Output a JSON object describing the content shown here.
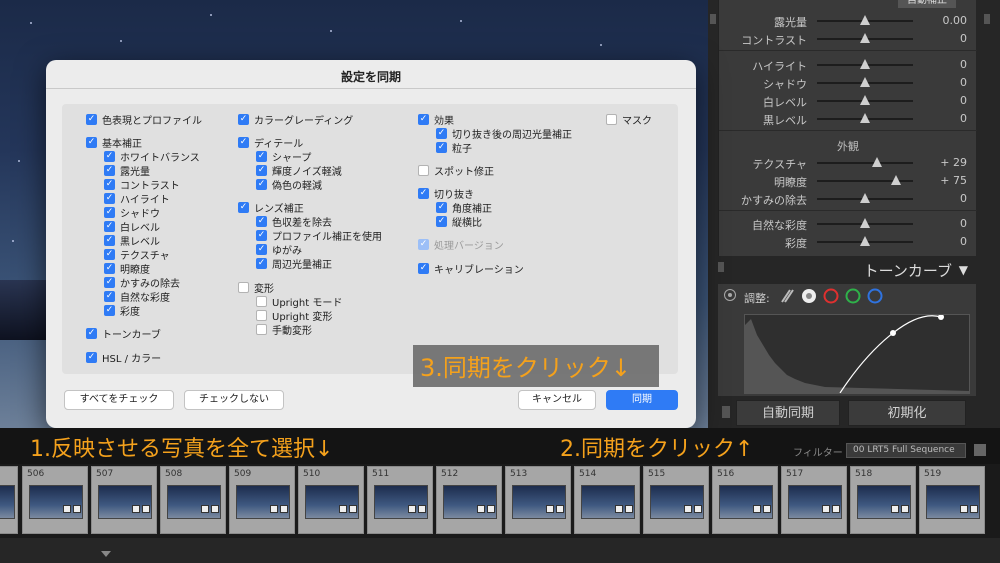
{
  "right_panel": {
    "auto_tab": "自動補正",
    "rows_top": [
      {
        "label": "露光量",
        "value": "0.00",
        "pos": 0.5
      },
      {
        "label": "コントラスト",
        "value": "0",
        "pos": 0.5
      }
    ],
    "rows_tone": [
      {
        "label": "ハイライト",
        "value": "0",
        "pos": 0.5
      },
      {
        "label": "シャドウ",
        "value": "0",
        "pos": 0.5
      },
      {
        "label": "白レベル",
        "value": "0",
        "pos": 0.5
      },
      {
        "label": "黒レベル",
        "value": "0",
        "pos": 0.5
      }
    ],
    "presence_header": "外観",
    "rows_presence": [
      {
        "label": "テクスチャ",
        "value": "+ 29",
        "pos": 0.62
      },
      {
        "label": "明瞭度",
        "value": "+ 75",
        "pos": 0.82
      },
      {
        "label": "かすみの除去",
        "value": "0",
        "pos": 0.5
      }
    ],
    "rows_color": [
      {
        "label": "自然な彩度",
        "value": "0",
        "pos": 0.5
      },
      {
        "label": "彩度",
        "value": "0",
        "pos": 0.5
      }
    ],
    "tone_curve_title": "トーンカーブ",
    "tone_curve_toggle": "▼",
    "curve_adjust_label": "調整:",
    "btn_auto_sync": "自動同期",
    "btn_reset": "初期化"
  },
  "dialog": {
    "title": "設定を同期",
    "col1": [
      {
        "label": "色表現とプロファイル",
        "checked": true,
        "indent": false
      },
      {
        "label": "基本補正",
        "checked": true,
        "indent": false
      },
      {
        "label": "ホワイトバランス",
        "checked": true,
        "indent": true
      },
      {
        "label": "露光量",
        "checked": true,
        "indent": true
      },
      {
        "label": "コントラスト",
        "checked": true,
        "indent": true
      },
      {
        "label": "ハイライト",
        "checked": true,
        "indent": true
      },
      {
        "label": "シャドウ",
        "checked": true,
        "indent": true
      },
      {
        "label": "白レベル",
        "checked": true,
        "indent": true
      },
      {
        "label": "黒レベル",
        "checked": true,
        "indent": true
      },
      {
        "label": "テクスチャ",
        "checked": true,
        "indent": true
      },
      {
        "label": "明瞭度",
        "checked": true,
        "indent": true
      },
      {
        "label": "かすみの除去",
        "checked": true,
        "indent": true
      },
      {
        "label": "自然な彩度",
        "checked": true,
        "indent": true
      },
      {
        "label": "彩度",
        "checked": true,
        "indent": true
      },
      {
        "label": "トーンカーブ",
        "checked": true,
        "indent": false
      },
      {
        "label": "HSL / カラー",
        "checked": true,
        "indent": false
      }
    ],
    "col2": [
      {
        "label": "カラーグレーディング",
        "checked": true,
        "indent": false
      },
      {
        "label": "ディテール",
        "checked": true,
        "indent": false
      },
      {
        "label": "シャープ",
        "checked": true,
        "indent": true
      },
      {
        "label": "輝度ノイズ軽減",
        "checked": true,
        "indent": true
      },
      {
        "label": "偽色の軽減",
        "checked": true,
        "indent": true
      },
      {
        "label": "レンズ補正",
        "checked": true,
        "indent": false
      },
      {
        "label": "色収差を除去",
        "checked": true,
        "indent": true
      },
      {
        "label": "プロファイル補正を使用",
        "checked": true,
        "indent": true
      },
      {
        "label": "ゆがみ",
        "checked": true,
        "indent": true
      },
      {
        "label": "周辺光量補正",
        "checked": true,
        "indent": true
      },
      {
        "label": "変形",
        "checked": false,
        "indent": false
      },
      {
        "label": "Upright モード",
        "checked": false,
        "indent": true
      },
      {
        "label": "Upright 変形",
        "checked": false,
        "indent": true
      },
      {
        "label": "手動変形",
        "checked": false,
        "indent": true
      }
    ],
    "col3": [
      {
        "label": "効果",
        "checked": true,
        "indent": false
      },
      {
        "label": "切り抜き後の周辺光量補正",
        "checked": true,
        "indent": true
      },
      {
        "label": "粒子",
        "checked": true,
        "indent": true
      },
      {
        "label": "スポット修正",
        "checked": false,
        "indent": false
      },
      {
        "label": "切り抜き",
        "checked": true,
        "indent": false
      },
      {
        "label": "角度補正",
        "checked": true,
        "indent": true
      },
      {
        "label": "縦横比",
        "checked": true,
        "indent": true
      },
      {
        "label": "処理バージョン",
        "checked": true,
        "indent": false,
        "disabled": true
      },
      {
        "label": "キャリブレーション",
        "checked": true,
        "indent": false
      }
    ],
    "col4": [
      {
        "label": "マスク",
        "checked": false,
        "indent": false
      }
    ],
    "btn_check_all": "すべてをチェック",
    "btn_check_none": "チェックしない",
    "btn_cancel": "キャンセル",
    "btn_sync": "同期"
  },
  "annotations": {
    "step1": "1.反映させる写真を全て選択↓",
    "step2": "2.同期をクリック↑",
    "step3": "3.同期をクリック↓",
    "color": "#f4a11c"
  },
  "filmstrip": {
    "filter_label": "フィルター :",
    "filter_value": "00 LRT5 Full Sequence",
    "thumbs": [
      "506",
      "507",
      "508",
      "509",
      "510",
      "511",
      "512",
      "513",
      "514",
      "515",
      "516",
      "517",
      "518",
      "519"
    ]
  }
}
